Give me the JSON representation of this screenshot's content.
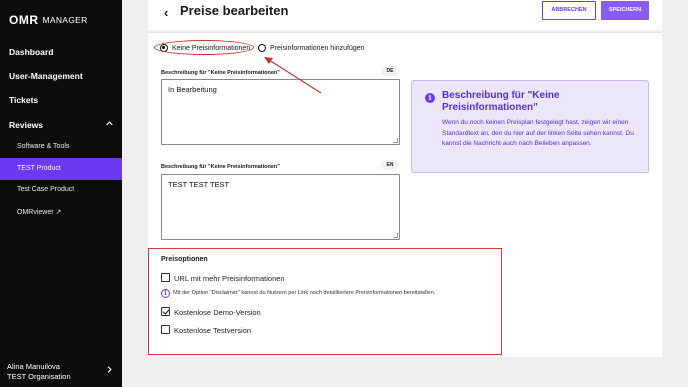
{
  "app": {
    "logo": "OMR",
    "logo_sub": "MANAGER"
  },
  "sidebar": {
    "items": [
      {
        "label": "Dashboard"
      },
      {
        "label": "User-Management"
      },
      {
        "label": "Tickets"
      },
      {
        "label": "Reviews"
      }
    ],
    "subitems": [
      {
        "label": "Software & Tools"
      },
      {
        "label": "TEST Product"
      },
      {
        "label": "Test Case Product"
      },
      {
        "label": "OMRviewer ↗"
      }
    ],
    "user": {
      "name": "Alina Manuilova",
      "org": "TEST Organisation"
    }
  },
  "header": {
    "title": "Preise bearbeiten",
    "cancel_label": "ABBRECHEN",
    "save_label": "SPEICHERN"
  },
  "pricing_mode": {
    "option_none": "Keine Preisinformationen",
    "option_add": "Preisinformationen hinzufügen",
    "selected": "Keine Preisinformationen"
  },
  "fields": {
    "de": {
      "label": "Beschreibung für \"Keine Preisinformationen\"",
      "lang": "DE",
      "value": "In Bearbeitung"
    },
    "en": {
      "label": "Beschreibung für \"Keine Preisinformationen\"",
      "lang": "EN",
      "value": "TEST TEST TEST"
    }
  },
  "info": {
    "title": "Beschreibung für \"Keine Preisinformationen\"",
    "text": "Wenn du noch keinen Preisplan festgelegt hast, zeigen wir einen Standardtext an, den du hier auf der linken Seite sehen kannst. Du kannst die Nachricht auch nach Belieben anpassen."
  },
  "options": {
    "title": "Preisoptionen",
    "items": [
      {
        "label": "URL mit mehr Preisinformationen",
        "checked": false
      },
      {
        "label": "Kostenlose Demo-Version",
        "checked": true
      },
      {
        "label": "Kostenlose Testversion",
        "checked": false
      }
    ],
    "hint": "Mit der Option \"Disclaimer\" kannst du Nutzern per Link noch detailliertere Preisinformationen bereitstellen."
  },
  "colors": {
    "accent": "#6a39f0",
    "annotation": "#c0392b",
    "sidebar_bg": "#0d0d0d"
  }
}
